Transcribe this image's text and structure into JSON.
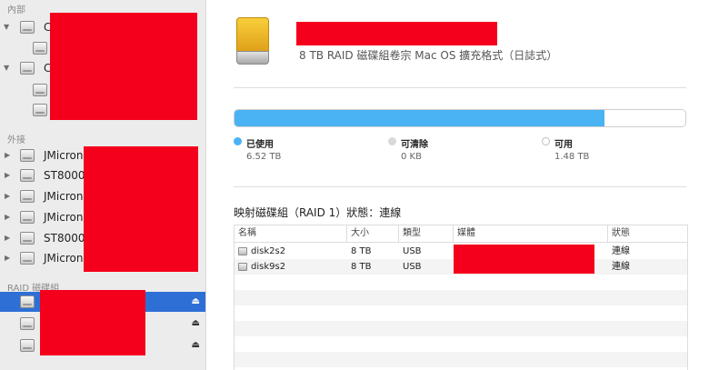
{
  "sidebar": {
    "sections": {
      "internal": "內部",
      "external": "外接",
      "raid": "RAID 磁碟組"
    },
    "internal_items": [
      {
        "label": "C",
        "level": 0,
        "disclosure": "open"
      },
      {
        "label": "",
        "level": 1,
        "disclosure": "none"
      },
      {
        "label": "C",
        "level": 0,
        "disclosure": "open"
      },
      {
        "label": "",
        "level": 1,
        "disclosure": "none"
      },
      {
        "label": "",
        "level": 1,
        "disclosure": "none"
      }
    ],
    "external_items": [
      {
        "label": "JMicron"
      },
      {
        "label": "ST8000"
      },
      {
        "label": "JMicron"
      },
      {
        "label": "JMicron"
      },
      {
        "label": "ST8000"
      },
      {
        "label": "JMicron"
      }
    ],
    "raid_items": [
      {
        "label": "",
        "selected": true,
        "eject": "⏏"
      },
      {
        "label": "",
        "selected": false,
        "eject": "⏏"
      },
      {
        "label": "",
        "selected": false,
        "eject": "⏏"
      }
    ]
  },
  "volume": {
    "subtitle": "8 TB RAID 磁碟組卷宗 Mac OS 擴充格式（日誌式）",
    "usage_fraction": 0.82,
    "legend": [
      {
        "label": "已使用",
        "value": "6.52 TB",
        "color": "#4ab3f4"
      },
      {
        "label": "可清除",
        "value": "0 KB",
        "color": "#d9d9d9"
      },
      {
        "label": "可用",
        "value": "1.48 TB",
        "color": "#ffffff"
      }
    ]
  },
  "raid": {
    "status_text": "映射磁碟組（RAID 1）狀態：連線",
    "columns": [
      "名稱",
      "大小",
      "類型",
      "媒體",
      "狀態"
    ],
    "rows": [
      {
        "name": "disk2s2",
        "size": "8 TB",
        "type": "USB",
        "media": "",
        "status": "連線"
      },
      {
        "name": "disk9s2",
        "size": "8 TB",
        "type": "USB",
        "media": "",
        "status": "連線"
      }
    ]
  }
}
